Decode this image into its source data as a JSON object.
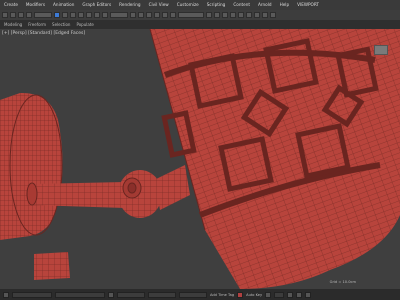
{
  "menu": {
    "items": [
      "Create",
      "Modifiers",
      "Animation",
      "Graph Editors",
      "Rendering",
      "Civil View",
      "Customize",
      "Scripting",
      "Content",
      "Arnold",
      "Help",
      "VIEWPORT"
    ]
  },
  "ribbon": {
    "tabs": [
      "Modeling",
      "Freeform",
      "Selection",
      "Populate"
    ]
  },
  "viewport": {
    "label": "[+] [Persp] [Standard] [Edged Faces]"
  },
  "status": {
    "grid_text": "Grid = 10.0cm",
    "autokey_label": "Auto Key",
    "setkey_label": "Set Key",
    "filters_label": "Key Filters...",
    "frame_value": "0",
    "time_text": "Add Time Tag"
  },
  "colors": {
    "mesh_fill": "#b8443c",
    "mesh_dark": "#6a2520",
    "viewport_bg": "#3f3f3f",
    "select_blue": "#3d7bd6"
  }
}
